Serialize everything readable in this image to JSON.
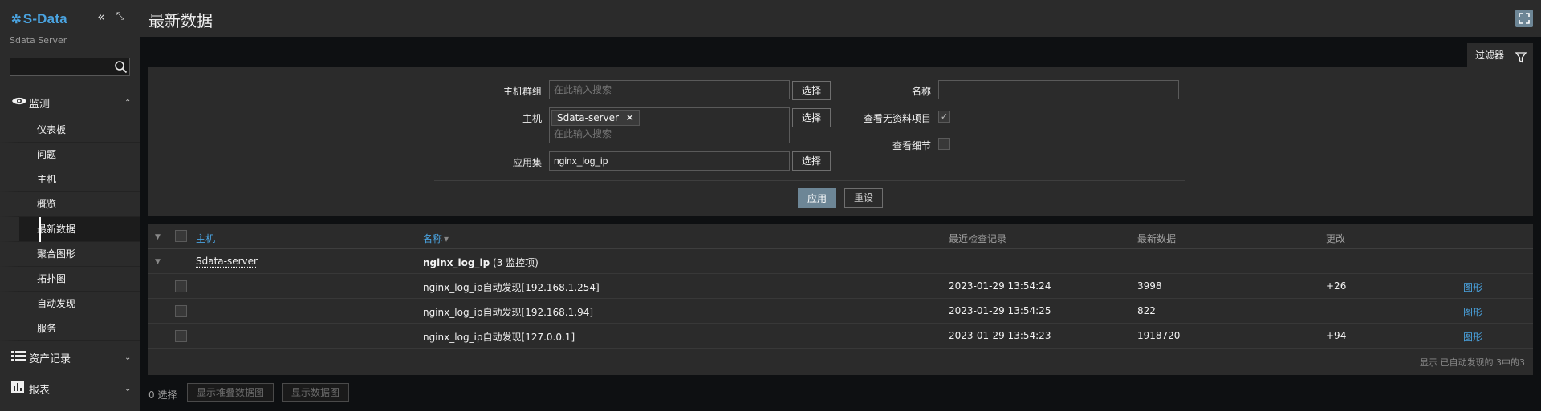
{
  "app": {
    "logo": "S-Data",
    "server_name": "Sdata Server"
  },
  "sidebar": {
    "search_value": "",
    "monitor": {
      "label": "监测",
      "items": [
        "仪表板",
        "问题",
        "主机",
        "概览",
        "最新数据",
        "聚合图形",
        "拓扑图",
        "自动发现",
        "服务"
      ],
      "active_index": 4
    },
    "assets": {
      "label": "资产记录"
    },
    "reports": {
      "label": "报表"
    }
  },
  "header": {
    "title": "最新数据"
  },
  "filter": {
    "tab_label": "过滤器",
    "host_groups_label": "主机群组",
    "host_groups_placeholder": "在此输入搜索",
    "select_label": "选择",
    "hosts_label": "主机",
    "host_tag": "Sdata-server",
    "hosts_placeholder": "在此输入搜索",
    "application_label": "应用集",
    "application_value": "nginx_log_ip",
    "name_label": "名称",
    "name_value": "",
    "show_no_data_label": "查看无资料项目",
    "show_no_data_checked": true,
    "show_details_label": "查看细节",
    "show_details_checked": false,
    "apply_label": "应用",
    "reset_label": "重设"
  },
  "table": {
    "headers": {
      "host": "主机",
      "name": "名称",
      "last_check": "最近检查记录",
      "last_value": "最新数据",
      "change": "更改"
    },
    "name_sort_indicator": "▾",
    "group": {
      "host": "Sdata-server",
      "name": "nginx_log_ip",
      "count": "(3 监控项)"
    },
    "rows": [
      {
        "name": "nginx_log_ip自动发现[192.168.1.254]",
        "last_check": "2023-01-29 13:54:24",
        "last_value": "3998",
        "change": "+26",
        "action": "图形"
      },
      {
        "name": "nginx_log_ip自动发现[192.168.1.94]",
        "last_check": "2023-01-29 13:54:25",
        "last_value": "822",
        "change": "",
        "action": "图形"
      },
      {
        "name": "nginx_log_ip自动发现[127.0.0.1]",
        "last_check": "2023-01-29 13:54:23",
        "last_value": "1918720",
        "change": "+94",
        "action": "图形"
      }
    ],
    "footer": "显示 已自动发现的 3中的3"
  },
  "actions": {
    "selected_count": "0 选择",
    "stacked_graph_label": "显示堆叠数据图",
    "graph_label": "显示数据图"
  },
  "colors": {
    "accent": "#4aa3e0",
    "button_primary": "#6d8696",
    "background": "#0e1012",
    "panel": "#2b2b2b"
  }
}
